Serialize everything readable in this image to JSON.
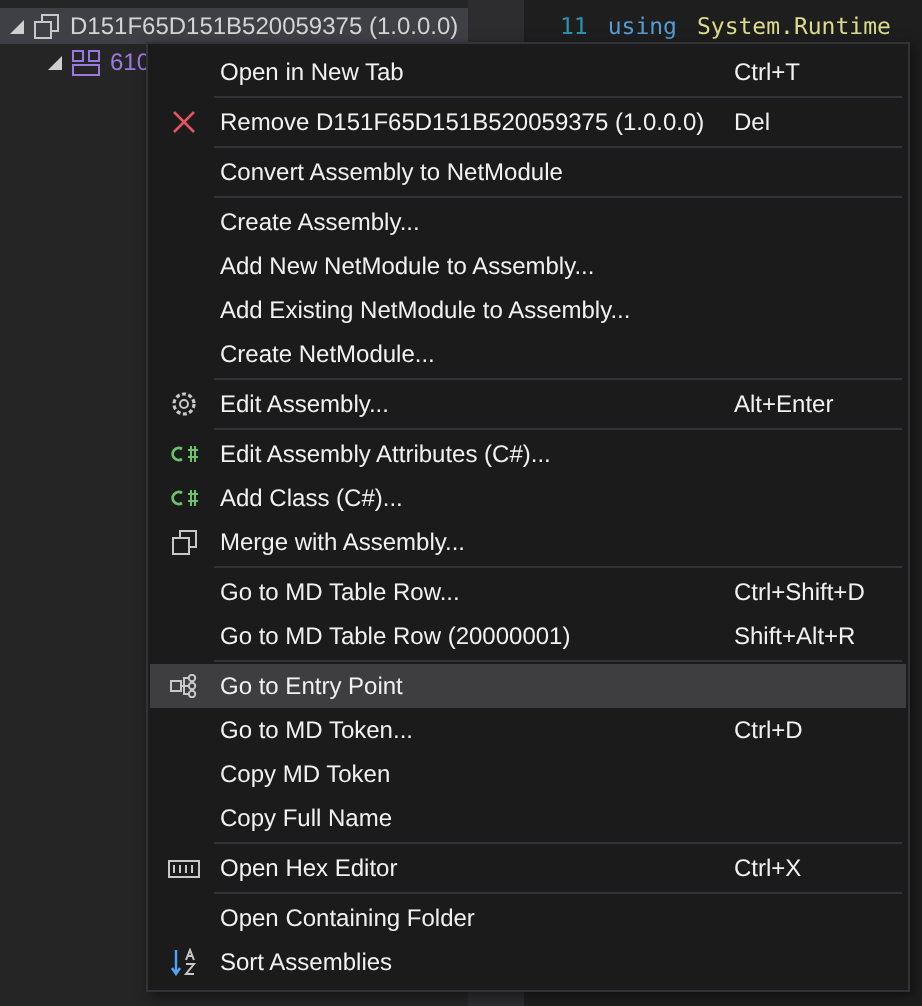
{
  "tree": {
    "selected_row": {
      "label": "D151F65D151B520059375 (1.0.0.0)",
      "expanded": true,
      "selected": true
    },
    "child_row": {
      "label": "610",
      "expanded": true
    }
  },
  "code": {
    "line_number": "11",
    "keyword": "using",
    "namespace": "System.Runtime"
  },
  "context_menu": [
    {
      "kind": "item",
      "label": "Open in New Tab",
      "shortcut": "Ctrl+T",
      "selected": false
    },
    {
      "kind": "separator"
    },
    {
      "kind": "item",
      "label": "Remove D151F65D151B520059375 (1.0.0.0)",
      "shortcut": "Del",
      "selected": false
    },
    {
      "kind": "separator"
    },
    {
      "kind": "item",
      "label": "Convert Assembly to NetModule",
      "selected": false
    },
    {
      "kind": "separator"
    },
    {
      "kind": "item",
      "label": "Create Assembly...",
      "selected": false
    },
    {
      "kind": "item",
      "label": "Add New NetModule to Assembly...",
      "selected": false
    },
    {
      "kind": "item",
      "label": "Add Existing NetModule to Assembly...",
      "selected": false
    },
    {
      "kind": "item",
      "label": "Create NetModule...",
      "selected": false
    },
    {
      "kind": "separator"
    },
    {
      "kind": "item",
      "label": "Edit Assembly...",
      "shortcut": "Alt+Enter",
      "selected": false
    },
    {
      "kind": "separator"
    },
    {
      "kind": "item",
      "label": "Edit Assembly Attributes (C#)...",
      "selected": false
    },
    {
      "kind": "item",
      "label": "Add Class (C#)...",
      "selected": false
    },
    {
      "kind": "item",
      "label": "Merge with Assembly...",
      "selected": false
    },
    {
      "kind": "separator"
    },
    {
      "kind": "item",
      "label": "Go to MD Table Row...",
      "shortcut": "Ctrl+Shift+D",
      "selected": false
    },
    {
      "kind": "item",
      "label": "Go to MD Table Row (20000001)",
      "shortcut": "Shift+Alt+R",
      "selected": false
    },
    {
      "kind": "separator"
    },
    {
      "kind": "item",
      "label": "Go to Entry Point",
      "selected": true
    },
    {
      "kind": "item",
      "label": "Go to MD Token...",
      "shortcut": "Ctrl+D",
      "selected": false
    },
    {
      "kind": "item",
      "label": "Copy MD Token",
      "selected": false
    },
    {
      "kind": "item",
      "label": "Copy Full Name",
      "selected": false
    },
    {
      "kind": "separator"
    },
    {
      "kind": "item",
      "label": "Open Hex Editor",
      "shortcut": "Ctrl+X",
      "selected": false
    },
    {
      "kind": "separator"
    },
    {
      "kind": "item",
      "label": "Open Containing Folder",
      "selected": false
    },
    {
      "kind": "item",
      "label": "Sort Assemblies",
      "selected": false
    }
  ]
}
